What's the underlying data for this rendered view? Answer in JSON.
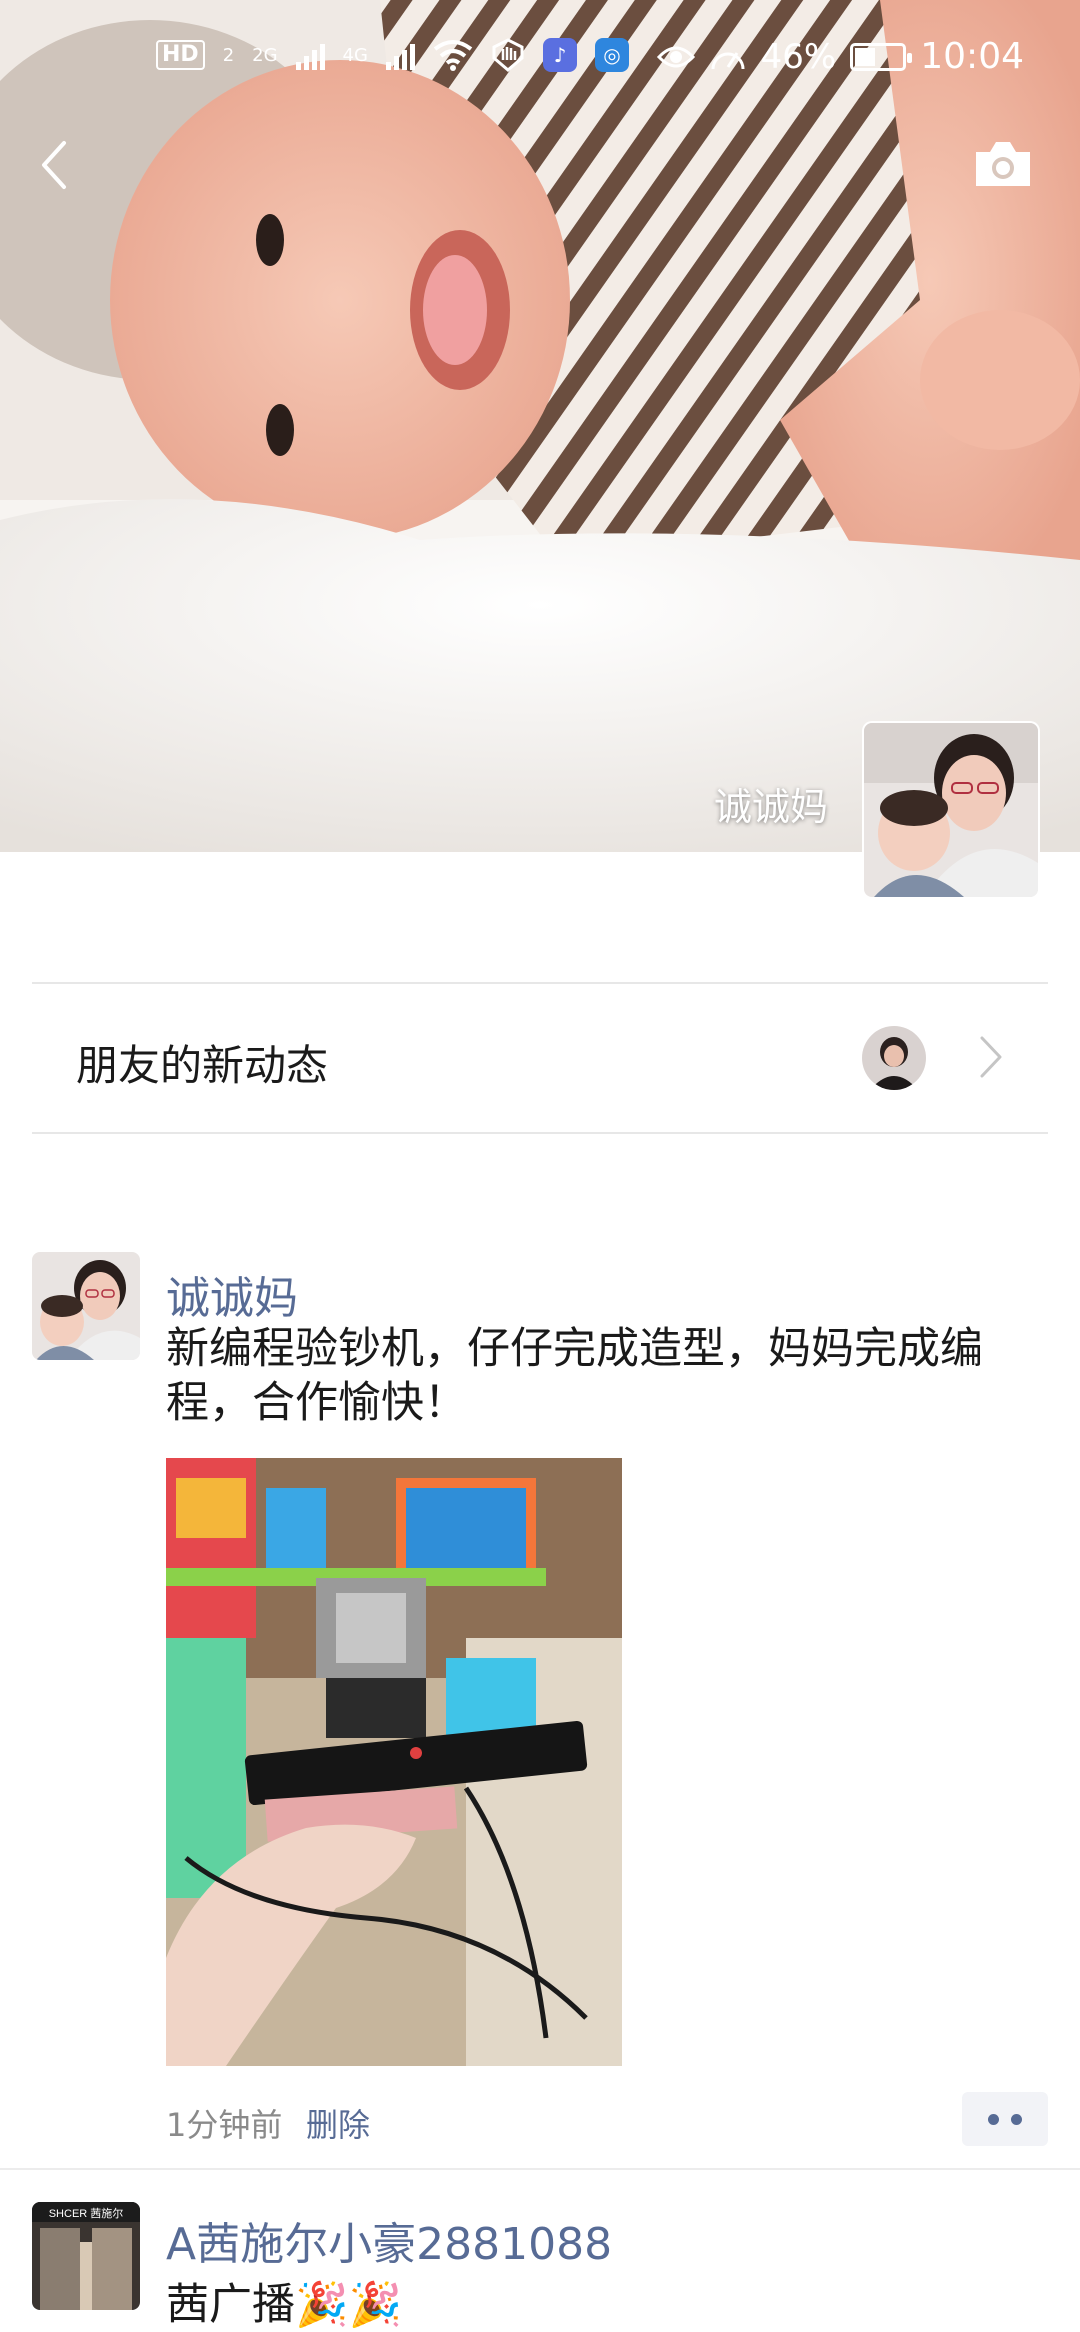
{
  "status_bar": {
    "hd_label": "HD",
    "sim_slot": "2",
    "net_type_1": "2G",
    "net_type_2": "4G",
    "battery_percent": "46%",
    "time": "10:04"
  },
  "cover": {
    "owner_name": "诚诚妈"
  },
  "friends_updates": {
    "label": "朋友的新动态"
  },
  "posts": [
    {
      "author": "诚诚妈",
      "text": "新编程验钞机，仔仔完成造型，妈妈完成编程，合作愉快！",
      "time": "1分钟前",
      "delete_label": "删除"
    },
    {
      "author": "A茜施尔小豪2881088",
      "text": "茜广播🎉🎉",
      "avatar_sign": "SHCER 茜施尔"
    }
  ],
  "colors": {
    "link": "#576b95",
    "text": "#1a1a1a",
    "muted": "#8a8a8a"
  }
}
